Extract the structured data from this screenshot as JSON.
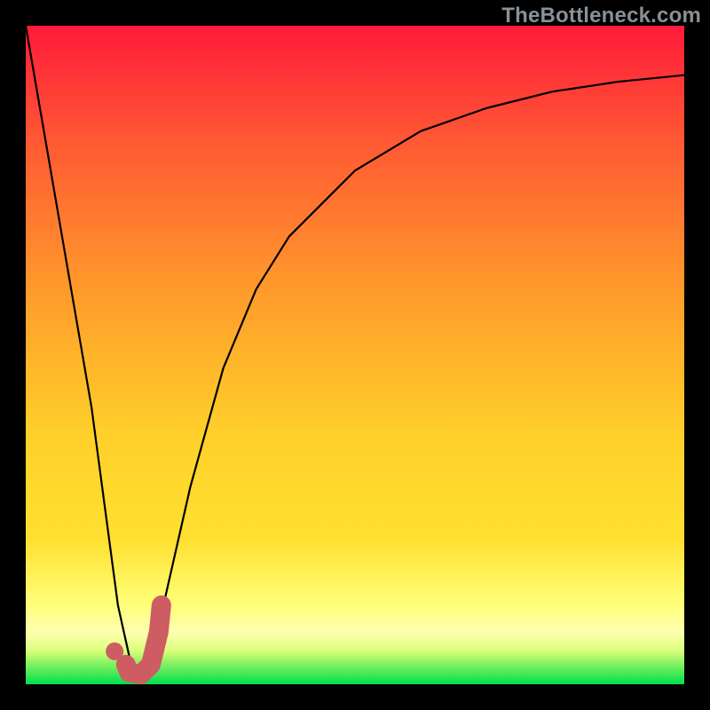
{
  "watermark": "TheBottleneck.com",
  "colors": {
    "frame": "#000000",
    "marker": "#cd5d63",
    "curve": "#000000",
    "gradient_top": "#ff1a3a",
    "gradient_mid_upper": "#ff9a2b",
    "gradient_mid": "#ffe031",
    "gradient_band": "#ffff7a",
    "gradient_bottom": "#00e050"
  },
  "chart_data": {
    "type": "line",
    "title": "",
    "xlabel": "",
    "ylabel": "",
    "xlim": [
      0,
      100
    ],
    "ylim": [
      0,
      100
    ],
    "annotations": [],
    "series": [
      {
        "name": "bottleneck-curve",
        "x": [
          0,
          5,
          10,
          14,
          16,
          18,
          20,
          25,
          30,
          35,
          40,
          50,
          60,
          70,
          80,
          90,
          100
        ],
        "values": [
          100,
          71,
          42,
          12,
          3,
          2,
          8,
          30,
          48,
          60,
          68,
          78,
          84,
          87.5,
          90,
          91.5,
          92.5
        ]
      }
    ],
    "markers": [
      {
        "name": "sweet-spot-dot",
        "x": 13.5,
        "y": 5,
        "shape": "circle"
      },
      {
        "name": "j-marker",
        "path": [
          {
            "x": 15.2,
            "y": 3.0
          },
          {
            "x": 15.7,
            "y": 1.8
          },
          {
            "x": 17.5,
            "y": 1.5
          },
          {
            "x": 19.0,
            "y": 3.0
          },
          {
            "x": 20.2,
            "y": 8.0
          },
          {
            "x": 20.6,
            "y": 12.0
          }
        ]
      }
    ]
  }
}
